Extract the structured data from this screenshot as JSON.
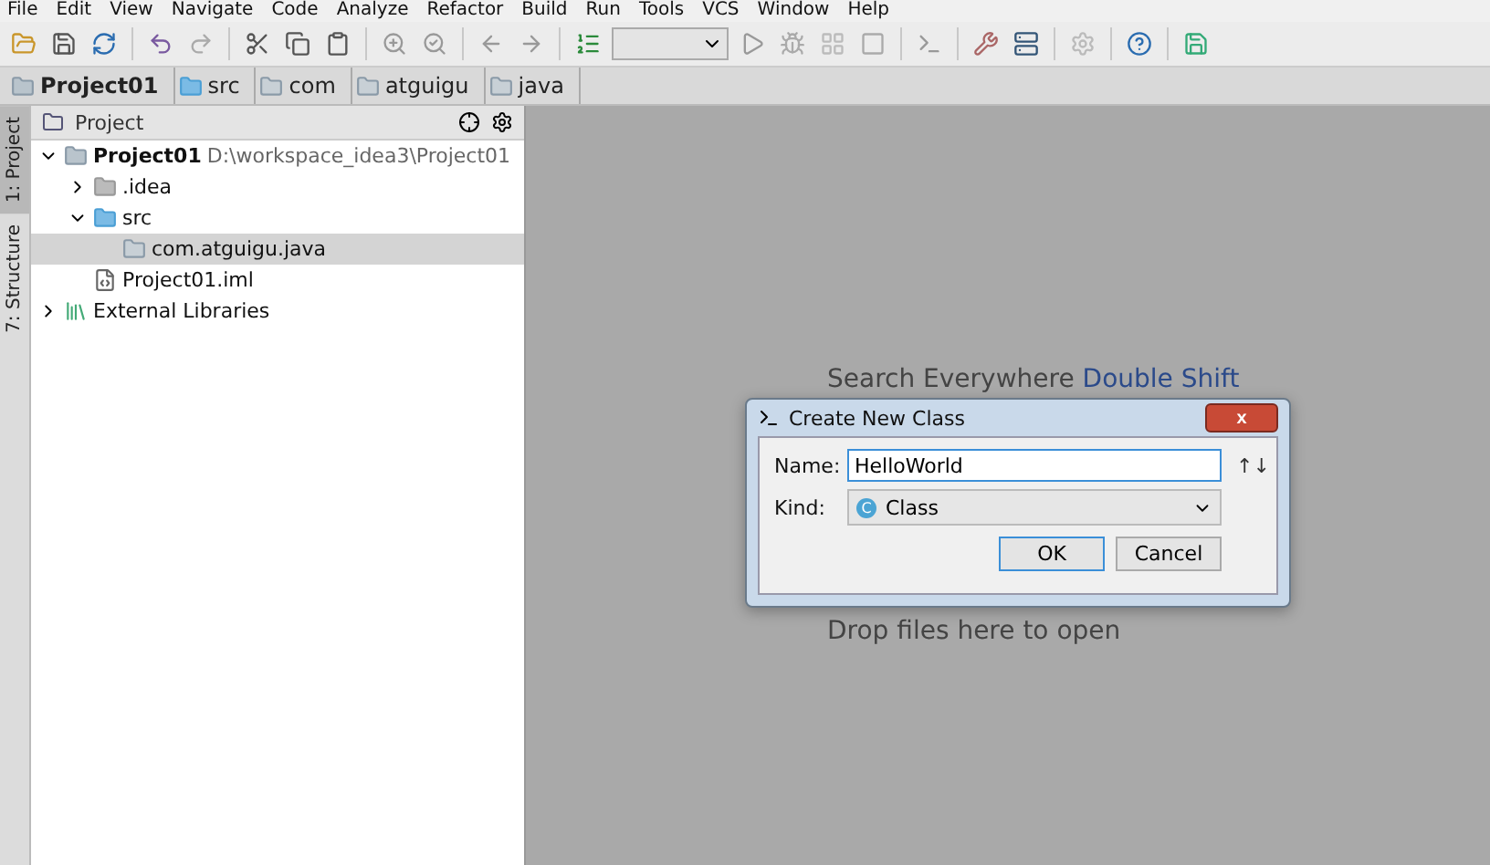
{
  "menu": [
    "File",
    "Edit",
    "View",
    "Navigate",
    "Code",
    "Analyze",
    "Refactor",
    "Build",
    "Run",
    "Tools",
    "VCS",
    "Window",
    "Help"
  ],
  "breadcrumbs": [
    {
      "label": "Project01",
      "kind": "module"
    },
    {
      "label": "src",
      "kind": "source"
    },
    {
      "label": "com",
      "kind": "package"
    },
    {
      "label": "atguigu",
      "kind": "package"
    },
    {
      "label": "java",
      "kind": "package"
    }
  ],
  "side_tabs": [
    {
      "label": "1: Project",
      "selected": true
    },
    {
      "label": "7: Structure",
      "selected": false
    }
  ],
  "project_panel": {
    "title": "Project",
    "tree": [
      {
        "label": "Project01",
        "path": "D:\\workspace_idea3\\Project01",
        "kind": "module",
        "expanded": true,
        "selected": false,
        "children": [
          {
            "label": ".idea",
            "kind": "folder",
            "expanded": false,
            "selected": false
          },
          {
            "label": "src",
            "kind": "source",
            "expanded": true,
            "selected": false,
            "children": [
              {
                "label": "com.atguigu.java",
                "kind": "package",
                "selected": true
              }
            ]
          },
          {
            "label": "Project01.iml",
            "kind": "file",
            "selected": false
          }
        ]
      },
      {
        "label": "External Libraries",
        "kind": "library",
        "expanded": false,
        "selected": false
      }
    ]
  },
  "editor": {
    "hint": "Search Everywhere",
    "hint_shortcut": "Double Shift",
    "drop_hint": "Drop files here to open"
  },
  "dialog": {
    "title": "Create New Class",
    "close": "x",
    "name_label": "Name:",
    "name_value": "HelloWorld",
    "sort_icon": "↑↓",
    "kind_label": "Kind:",
    "kind_value": "Class",
    "kind_badge": "C",
    "buttons": [
      {
        "label": "OK",
        "selected": true
      },
      {
        "label": "Cancel",
        "selected": false
      }
    ]
  }
}
